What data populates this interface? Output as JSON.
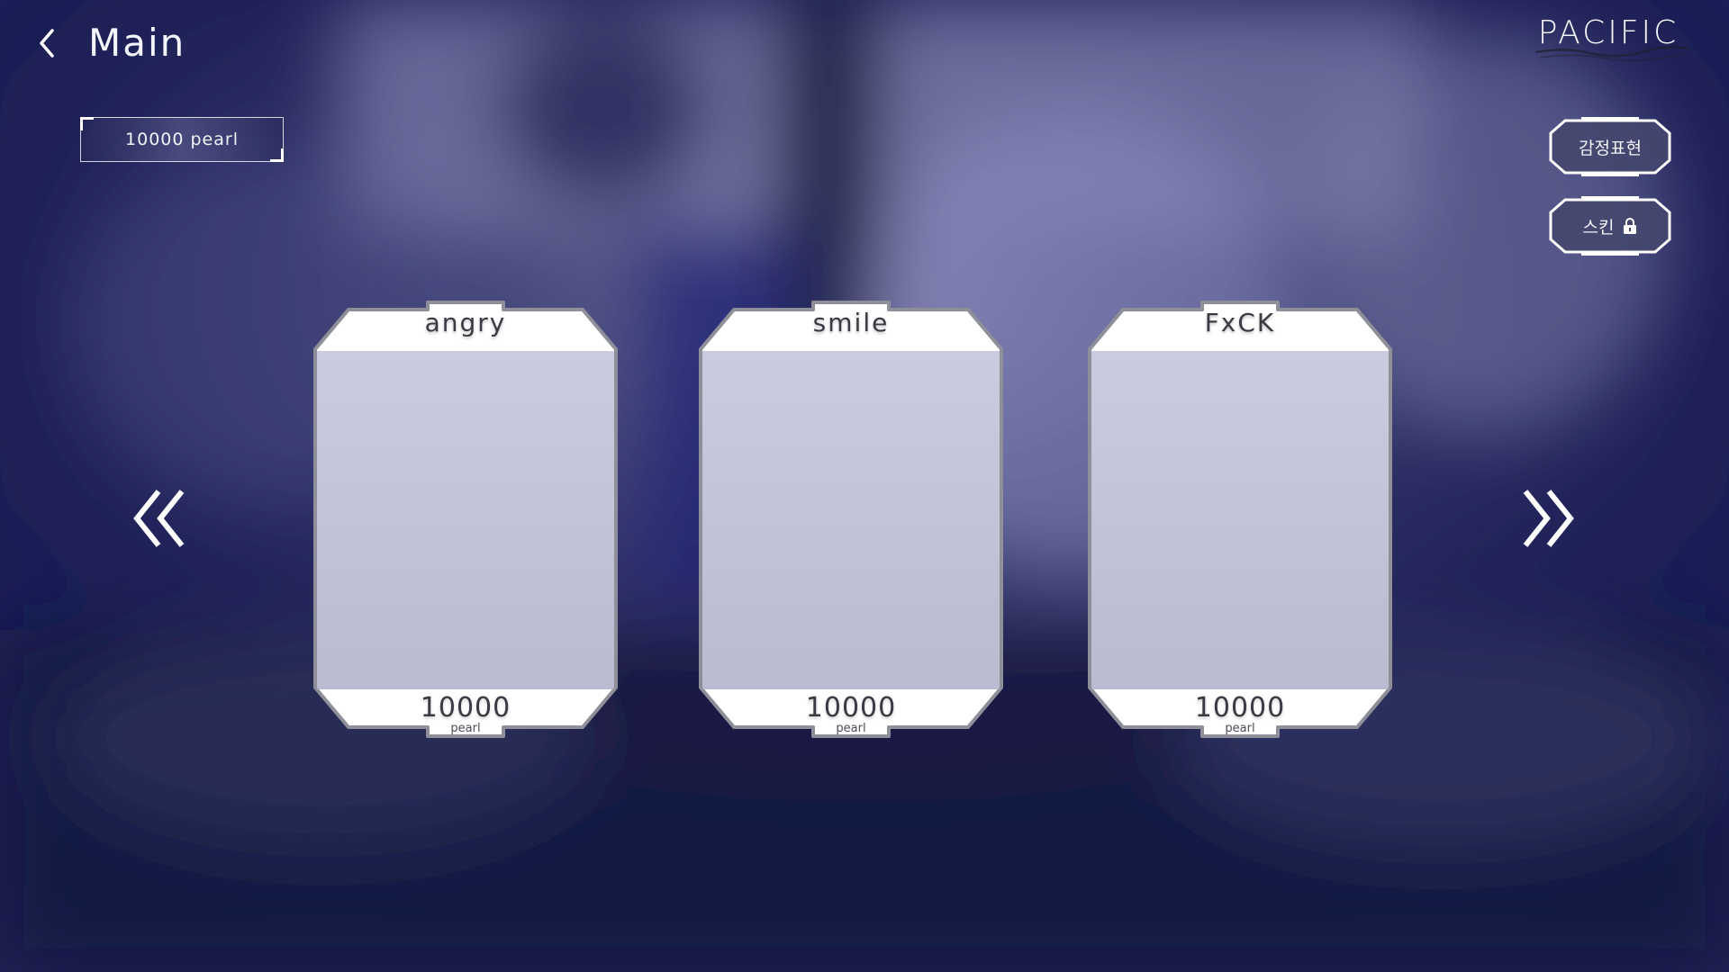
{
  "header": {
    "title": "Main",
    "logo": "PACIFIC"
  },
  "currency": {
    "value": "10000 pearl"
  },
  "side_buttons": {
    "emote_label": "감정표현",
    "skin_label": "스킨",
    "skin_icon": "lock-icon"
  },
  "cards": [
    {
      "name": "angry",
      "price": "10000",
      "unit": "pearl"
    },
    {
      "name": "smile",
      "price": "10000",
      "unit": "pearl"
    },
    {
      "name": "FxCK",
      "price": "10000",
      "unit": "pearl"
    }
  ],
  "colors": {
    "background": "#1b1d52",
    "card_frame": "#ffffff",
    "card_border": "#8e8f98",
    "card_text": "#3a3a42",
    "button_fill": "#45476e"
  },
  "icons": {
    "back": "chevron-left-icon",
    "prev": "double-chevron-left-icon",
    "next": "double-chevron-right-icon"
  }
}
